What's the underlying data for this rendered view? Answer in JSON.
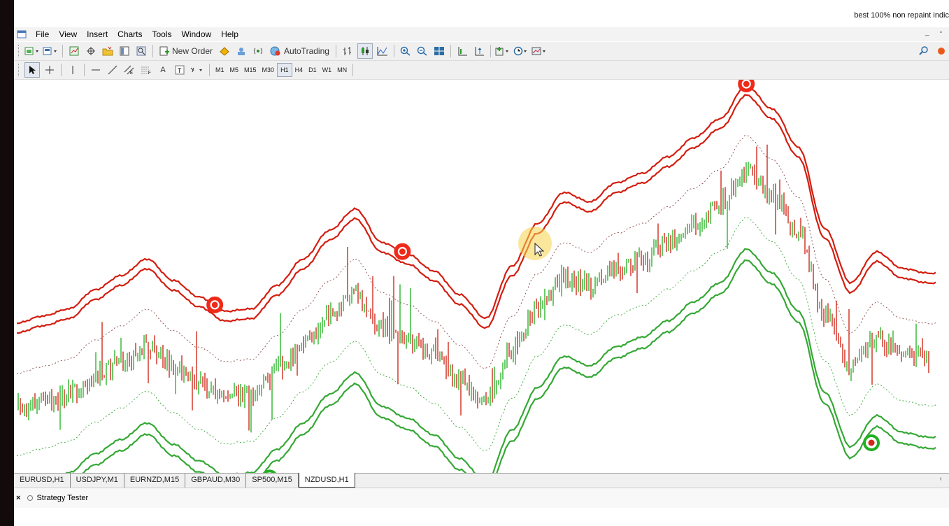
{
  "video_title": "best 100% non repaint indic",
  "menu": [
    "File",
    "View",
    "Insert",
    "Charts",
    "Tools",
    "Window",
    "Help"
  ],
  "window_controls": "_  5",
  "toolbar": {
    "new_order_label": "New Order",
    "autotrading_label": "AutoTrading"
  },
  "timeframes": [
    "M1",
    "M5",
    "M15",
    "M30",
    "H1",
    "H4",
    "D1",
    "W1",
    "MN"
  ],
  "active_timeframe": "H1",
  "chart_tabs": [
    "EURUSD,H1",
    "USDJPY,M1",
    "EURNZD,M15",
    "GBPAUD,M30",
    "SP500,M15",
    "NZDUSD,H1"
  ],
  "active_chart_tab": "NZDUSD,H1",
  "tester_label": "Strategy Tester",
  "colors": {
    "bull": "#2bb52b",
    "bear": "#d12a1c",
    "upper_band": "#d31e10",
    "lower_band": "#35a835",
    "sell_signal": "#ef2a1a",
    "buy_signal": "#22b022"
  },
  "chart_data": {
    "type": "candlestick",
    "symbol": "NZDUSD",
    "timeframe": "H1",
    "title": "",
    "xlabel": "",
    "ylabel": "",
    "price_path": [
      0.0,
      0.03,
      0.06,
      0.14,
      0.2,
      0.27,
      0.18,
      0.11,
      0.05,
      0.06,
      0.16,
      0.27,
      0.39,
      0.48,
      0.34,
      0.29,
      0.22,
      0.12,
      0.02,
      0.24,
      0.42,
      0.55,
      0.51,
      0.59,
      0.63,
      0.7,
      0.78,
      0.86,
      1.0,
      0.9,
      0.74,
      0.4,
      0.17,
      0.3,
      0.23,
      0.21
    ],
    "upper_band_offset": 0.3,
    "lower_band_offset": 0.36,
    "signals": [
      {
        "type": "sell",
        "index": 7.6
      },
      {
        "type": "buy",
        "index": 9.7
      },
      {
        "type": "sell",
        "index": 14.8
      },
      {
        "type": "buy",
        "index": 18.0
      },
      {
        "type": "sell",
        "index": 28.0
      },
      {
        "type": "buy",
        "index": 32.8
      }
    ],
    "grid": false,
    "legend": "none"
  }
}
